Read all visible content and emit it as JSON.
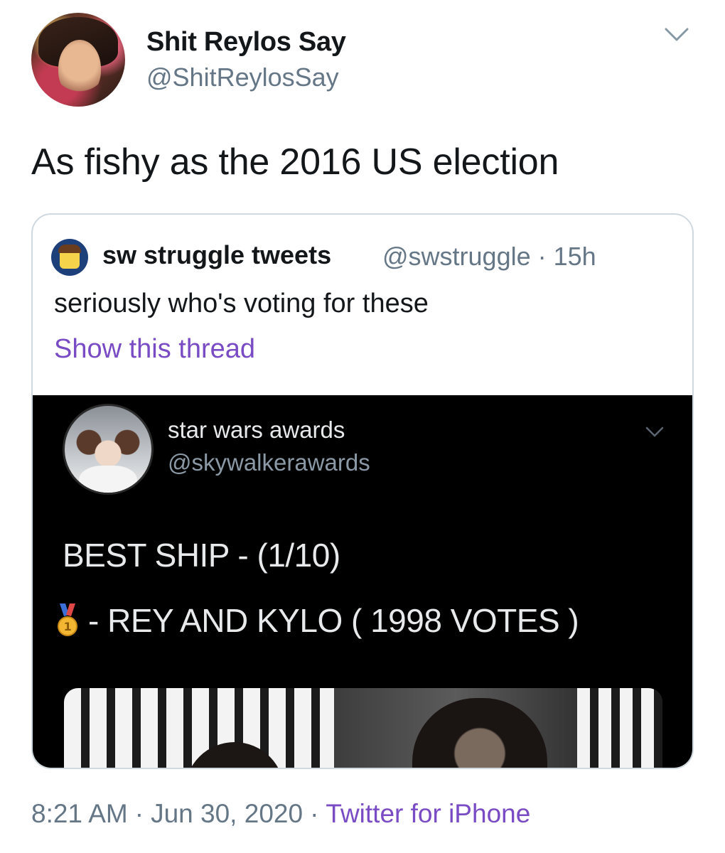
{
  "author": {
    "display_name": "Shit Reylos Say",
    "handle": "@ShitReylosSay"
  },
  "tweet": {
    "text": "As fishy as the 2016 US election"
  },
  "quoted_tweet": {
    "display_name": "sw struggle tweets",
    "meta": "@swstruggle · 15h",
    "text": "seriously who's voting for these",
    "show_thread": "Show this thread",
    "embedded": {
      "display_name": "star wars awards",
      "handle": "@skywalkerawards",
      "line1": "BEST SHIP - (1/10)",
      "line2": "- REY AND KYLO ( 1998 VOTES )",
      "medal_icon": "first-place-medal-icon"
    }
  },
  "footer": {
    "time": "8:21 AM",
    "date": "Jun 30, 2020",
    "separator": "·",
    "source": "Twitter for iPhone"
  },
  "colors": {
    "text": "#14171a",
    "muted": "#657786",
    "link": "#794bc4",
    "border": "#cfd9de",
    "embed_bg": "#000000"
  }
}
